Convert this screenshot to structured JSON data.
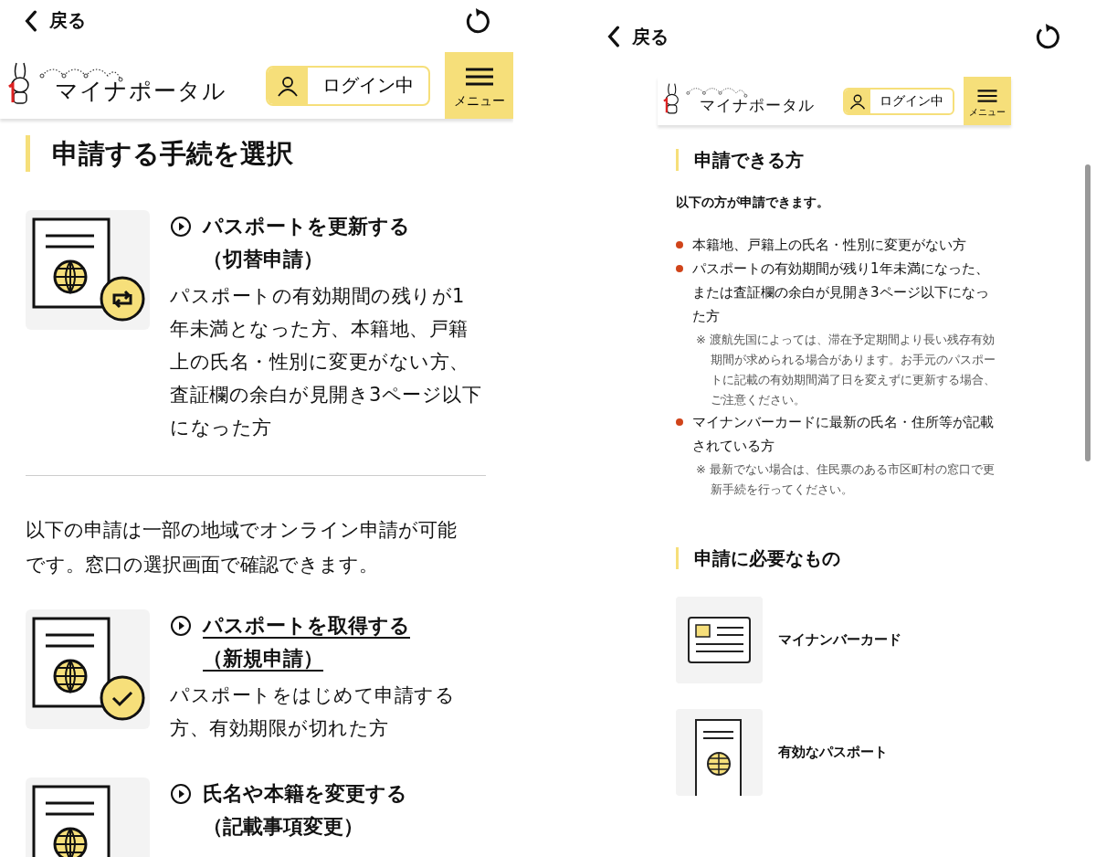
{
  "left": {
    "back": "戻る",
    "header": {
      "site_name": "マイナポータル",
      "login": "ログイン中",
      "menu": "メニュー"
    },
    "title": "申請する手続を選択",
    "procedures": [
      {
        "kind": "renew",
        "title": "パスポートを更新する",
        "subtitle": "（切替申請）",
        "link": false,
        "description": "パスポートの有効期間の残りが1年未満となった方、本籍地、戸籍上の氏名・性別に変更がない方、査証欄の余白が見開き3ページ以下になった方"
      }
    ],
    "notice": "以下の申請は一部の地域でオンライン申請が可能です。窓口の選択画面で確認できます。",
    "regional_procedures": [
      {
        "kind": "check",
        "title": "パスポートを取得する",
        "subtitle": "（新規申請）",
        "link": true,
        "description": "パスポートをはじめて申請する方、有効期限が切れた方"
      },
      {
        "kind": "plain",
        "title": "氏名や本籍を変更する",
        "subtitle": "（記載事項変更）",
        "link": false
      }
    ]
  },
  "right": {
    "back": "戻る",
    "header": {
      "site_name": "マイナポータル",
      "login": "ログイン中",
      "menu": "メニュー"
    },
    "eligibility": {
      "title": "申請できる方",
      "lead": "以下の方が申請できます。",
      "items": [
        {
          "text": "本籍地、戸籍上の氏名・性別に変更がない方"
        },
        {
          "text": "パスポートの有効期間が残り1年未満になった、または査証欄の余白が見開き3ページ以下になった方",
          "note": "※ 渡航先国によっては、滞在予定期間より長い残存有効期間が求められる場合があります。お手元のパスポートに記載の有効期間満了日を変えずに更新する場合、ご注意ください。"
        },
        {
          "text": "マイナンバーカードに最新の氏名・住所等が記載されている方",
          "note": "※ 最新でない場合は、住民票のある市区町村の窓口で更新手続を行ってください。"
        }
      ]
    },
    "requirements": {
      "title": "申請に必要なもの",
      "items": [
        {
          "kind": "card",
          "label": "マイナンバーカード"
        },
        {
          "kind": "passport",
          "label": "有効なパスポート"
        }
      ]
    }
  }
}
